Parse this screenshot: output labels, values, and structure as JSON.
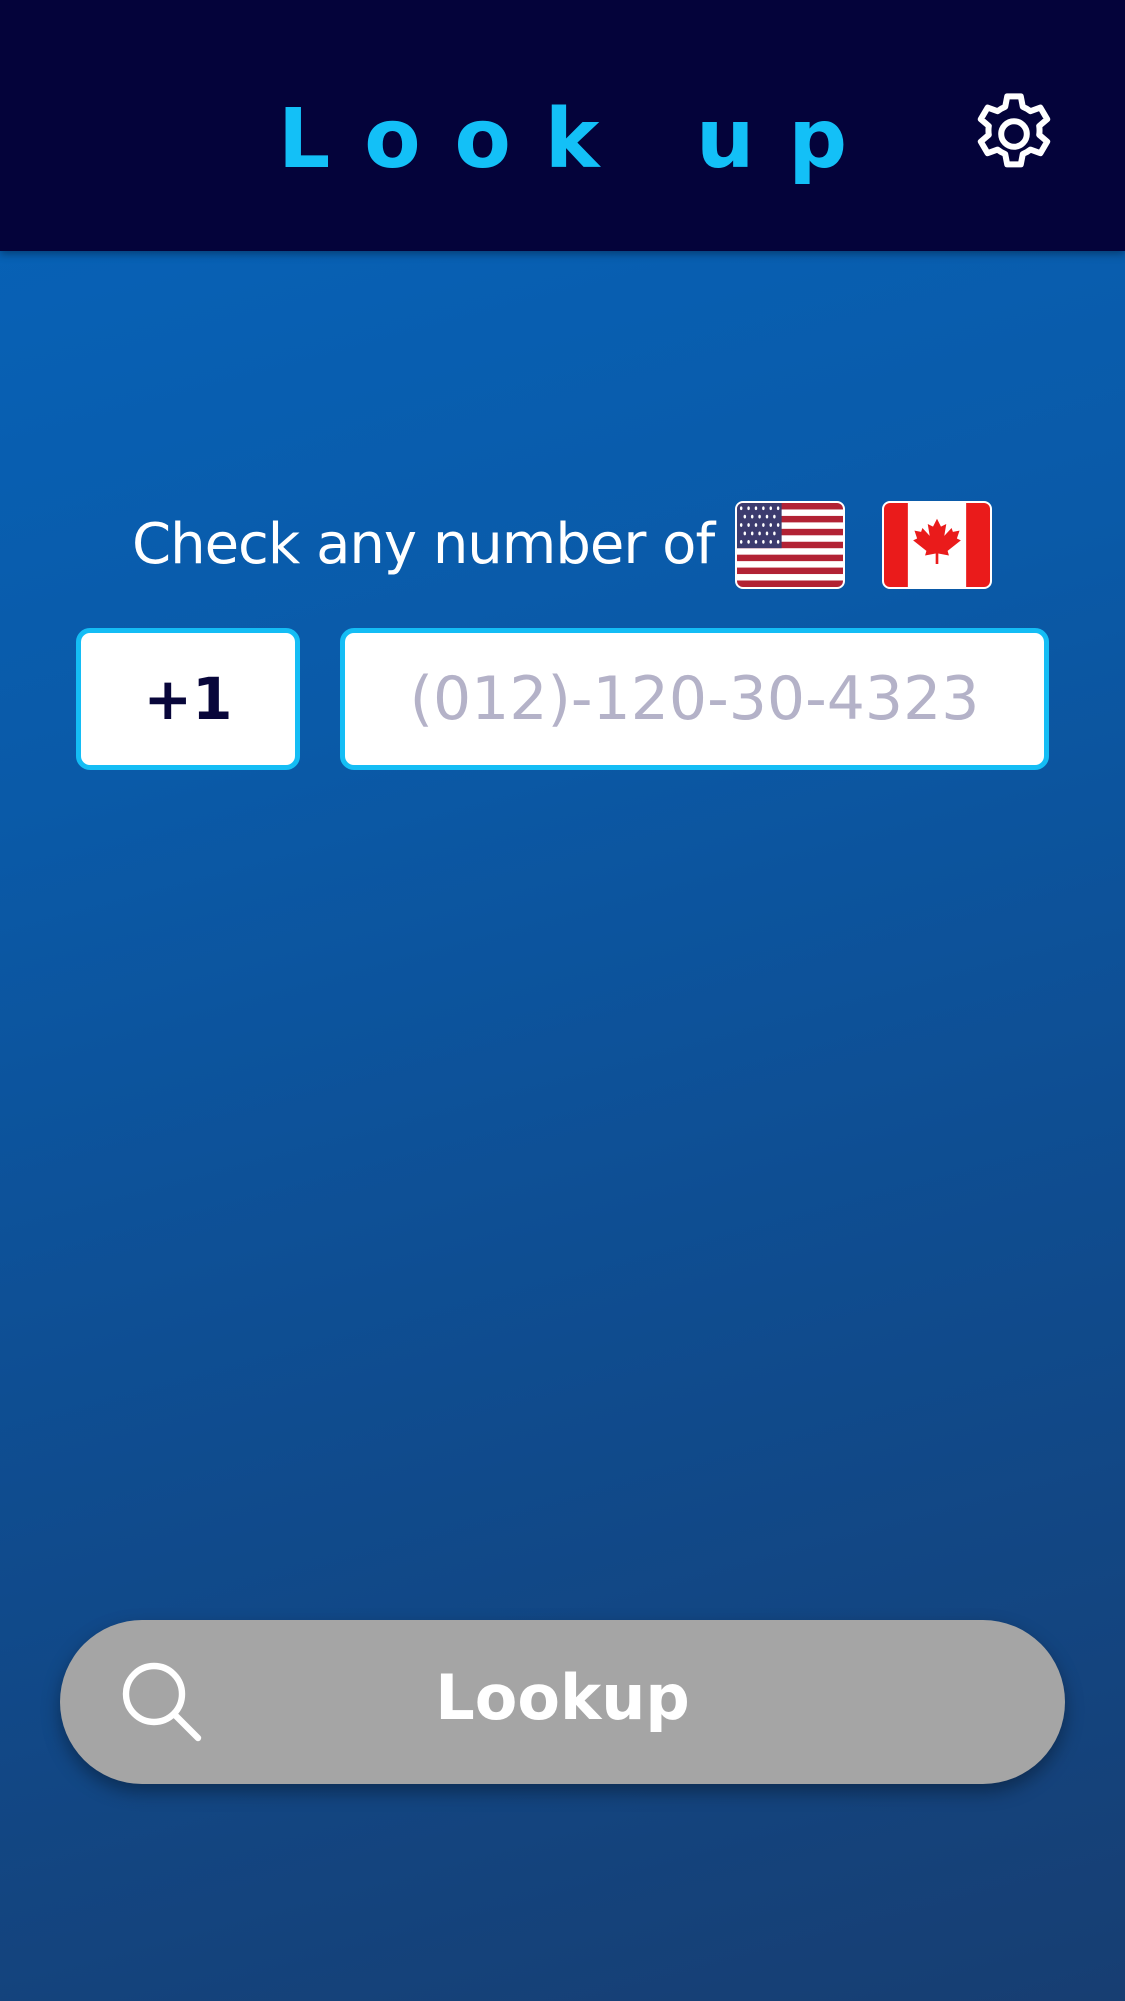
{
  "header": {
    "title": "Look up",
    "settings_icon": "gear-icon"
  },
  "prompt": {
    "text": "Check any number of",
    "flags": [
      "us-flag-icon",
      "canada-flag-icon"
    ]
  },
  "phone": {
    "country_code": "+1",
    "value": "",
    "placeholder": "(012)-120-30-4323"
  },
  "action": {
    "lookup_label": "Lookup",
    "icon": "search-icon"
  },
  "colors": {
    "header_bg": "#04033a",
    "title": "#13c0f7",
    "input_border": "#14bdf5",
    "button_bg": "#a5a5a5"
  }
}
